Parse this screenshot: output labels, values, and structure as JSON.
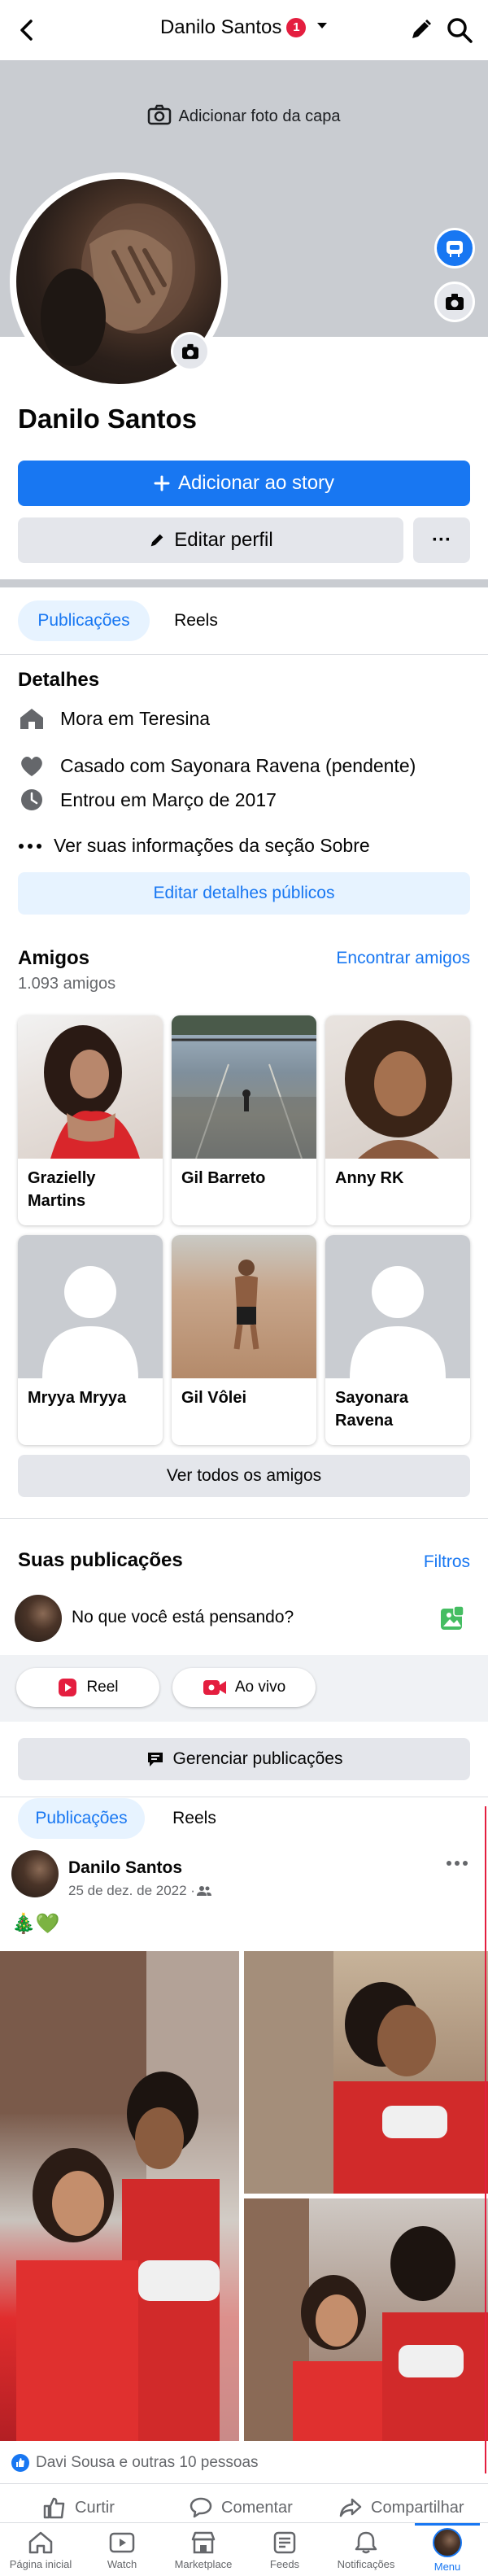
{
  "header": {
    "title": "Danilo Santos",
    "badge_count": "1"
  },
  "cover": {
    "add_photo_label": "Adicionar foto da capa"
  },
  "profile": {
    "name": "Danilo Santos",
    "add_story_label": "Adicionar ao story",
    "edit_profile_label": "Editar perfil",
    "more_label": "···"
  },
  "tabs": [
    {
      "label": "Publicações",
      "active": true
    },
    {
      "label": "Reels",
      "active": false
    }
  ],
  "details": {
    "heading": "Detalhes",
    "lives_prefix": "Mora em ",
    "lives_city": "Teresina",
    "relationship_prefix": "Casado com ",
    "relationship_name": "Sayonara Ravena",
    "relationship_suffix": " (pendente)",
    "joined": "Entrou em Março de 2017",
    "see_about": "Ver suas informações da seção Sobre",
    "edit_public_label": "Editar detalhes públicos"
  },
  "friends": {
    "heading": "Amigos",
    "count": "1.093 amigos",
    "find_label": "Encontrar amigos",
    "list": [
      {
        "name": "Grazielly Martins"
      },
      {
        "name": "Gil Barreto"
      },
      {
        "name": "Anny RK"
      },
      {
        "name": "Mryya Mryya"
      },
      {
        "name": "Gil Vôlei"
      },
      {
        "name": "Sayonara Ravena"
      }
    ],
    "see_all_label": "Ver todos os amigos"
  },
  "composer": {
    "heading": "Suas publicações",
    "filters_label": "Filtros",
    "placeholder": "No que você está pensando?",
    "reel_label": "Reel",
    "live_label": "Ao vivo",
    "manage_label": "Gerenciar publicações"
  },
  "post": {
    "author": "Danilo Santos",
    "date": "25 de dez. de 2022 · ",
    "text": "🎄💚",
    "reactions": "Davi Sousa e outras 10 pessoas",
    "like_label": "Curtir",
    "comment_label": "Comentar",
    "share_label": "Compartilhar"
  },
  "bottom_nav": [
    {
      "label": "Página inicial",
      "icon": "home-icon"
    },
    {
      "label": "Watch",
      "icon": "watch-icon"
    },
    {
      "label": "Marketplace",
      "icon": "marketplace-icon"
    },
    {
      "label": "Feeds",
      "icon": "feeds-icon"
    },
    {
      "label": "Notificações",
      "icon": "bell-icon"
    },
    {
      "label": "Menu",
      "icon": "menu-avatar-icon",
      "active": true
    }
  ],
  "colors": {
    "accent": "#1877f2",
    "badge": "#e41e3f",
    "muted": "#65676b",
    "divider": "#c9ccd1"
  }
}
